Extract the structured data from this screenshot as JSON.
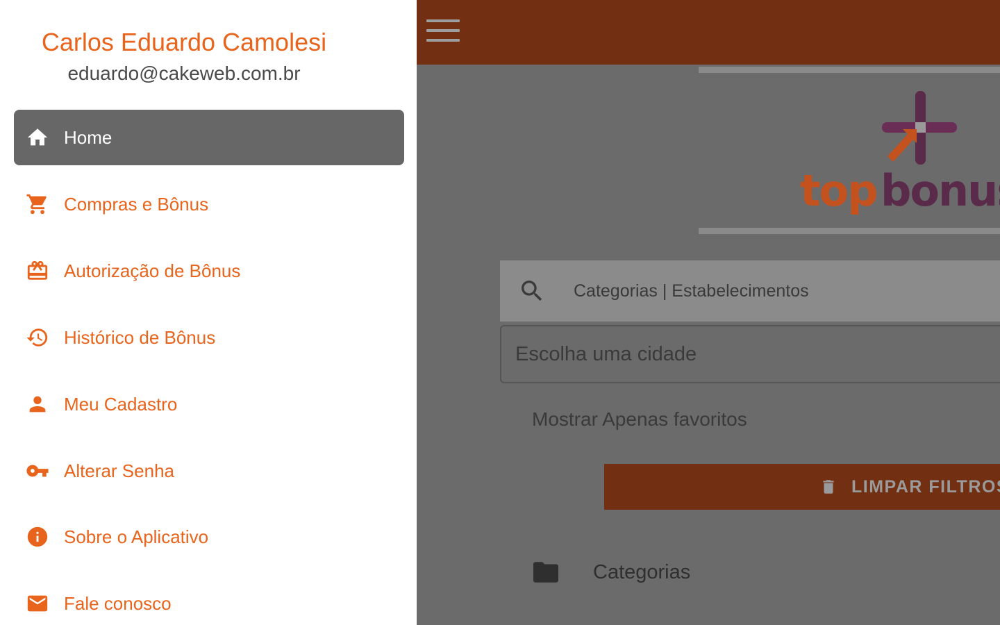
{
  "drawer": {
    "user_name": "Carlos Eduardo Camolesi",
    "user_email": "eduardo@cakeweb.com.br",
    "items": [
      {
        "label": "Home",
        "icon": "home-icon",
        "active": true
      },
      {
        "label": "Compras e Bônus",
        "icon": "cart-icon"
      },
      {
        "label": "Autorização de Bônus",
        "icon": "gift-card-icon"
      },
      {
        "label": "Histórico de Bônus",
        "icon": "history-icon"
      },
      {
        "label": "Meu Cadastro",
        "icon": "person-icon"
      },
      {
        "label": "Alterar Senha",
        "icon": "key-icon"
      },
      {
        "label": "Sobre o Aplicativo",
        "icon": "info-icon"
      },
      {
        "label": "Fale conosco",
        "icon": "mail-icon"
      }
    ]
  },
  "main": {
    "menu_icon": "hamburger-menu-icon",
    "logo_text": "topbonus",
    "search_placeholder": "Categorias | Estabelecimentos",
    "city_placeholder": "Escolha uma cidade",
    "favorites_label": "Mostrar Apenas favoritos",
    "clear_button_label": "LIMPAR FILTROS",
    "categories_label": "Categorias"
  },
  "colors": {
    "accent": "#e8641c",
    "topbar": "#732f12",
    "active_item": "#676767",
    "overlay": "#6b6b6b"
  }
}
